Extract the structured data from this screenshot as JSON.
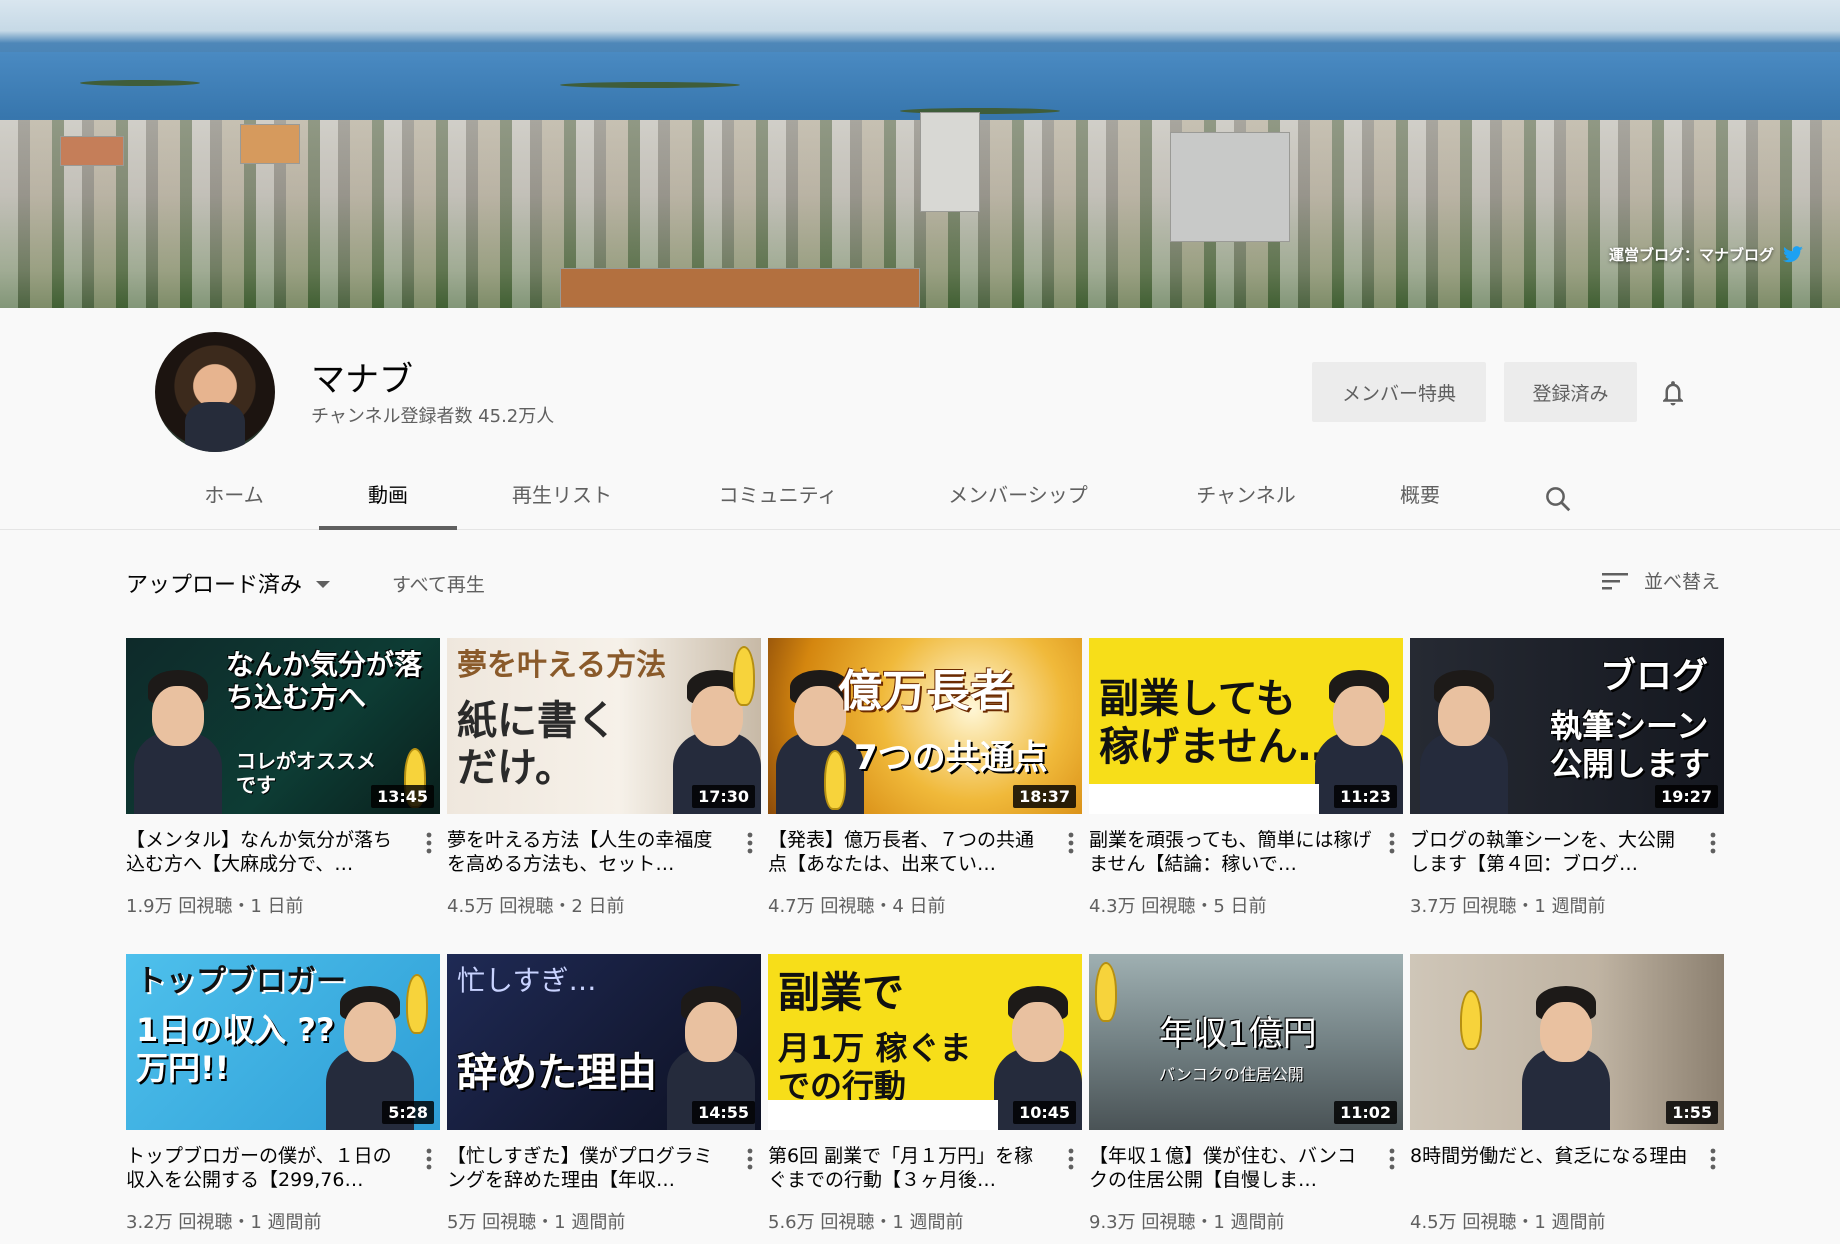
{
  "banner": {
    "blog_link": "運営ブログ：マナブログ"
  },
  "channel": {
    "name": "マナブ",
    "subscribers": "チャンネル登録者数 45.2万人"
  },
  "buttons": {
    "member": "メンバー特典",
    "subscribed": "登録済み"
  },
  "tabs": [
    {
      "label": "ホーム"
    },
    {
      "label": "動画",
      "active": true
    },
    {
      "label": "再生リスト"
    },
    {
      "label": "コミュニティ"
    },
    {
      "label": "メンバーシップ"
    },
    {
      "label": "チャンネル"
    },
    {
      "label": "概要"
    }
  ],
  "controls": {
    "uploads": "アップロード済み",
    "play_all": "すべて再生",
    "sort": "並べ替え"
  },
  "videos": [
    {
      "thumb": "なんか気分が落ち込む方へ",
      "thumb2": "コレがオススメです",
      "duration": "13:45",
      "title": "【メンタル】なんか気分が落ち込む方へ【大麻成分で、…",
      "meta": "1.9万 回視聴・1 日前"
    },
    {
      "thumb": "夢を叶える方法",
      "thumb2": "紙に書くだけ。",
      "duration": "17:30",
      "title": "夢を叶える方法【人生の幸福度を高める方法も、セット…",
      "meta": "4.5万 回視聴・2 日前"
    },
    {
      "thumb": "億万長者",
      "thumb2": "7つの共通点",
      "duration": "18:37",
      "title": "【発表】億万長者、７つの共通点【あなたは、出来てい…",
      "meta": "4.7万 回視聴・4 日前"
    },
    {
      "thumb": "副業しても",
      "thumb2": "稼げません…",
      "duration": "11:23",
      "title": "副業を頑張っても、簡単には稼げません【結論：稼いで…",
      "meta": "4.3万 回視聴・5 日前"
    },
    {
      "thumb": "ブログ",
      "thumb2": "執筆シーン公開します",
      "duration": "19:27",
      "title": "ブログの執筆シーンを、大公開します【第４回：ブログ…",
      "meta": "3.7万 回視聴・1 週間前"
    },
    {
      "thumb": "トップブロガー",
      "thumb2": "1日の収入 ??万円!!",
      "duration": "5:28",
      "title": "トップブロガーの僕が、１日の収入を公開する【299,76…",
      "meta": "3.2万 回視聴・1 週間前"
    },
    {
      "thumb": "忙しすぎ…",
      "thumb2": "辞めた理由",
      "duration": "14:55",
      "title": "【忙しすぎた】僕がプログラミングを辞めた理由【年収…",
      "meta": "5万 回視聴・1 週間前"
    },
    {
      "thumb": "副業で",
      "thumb2": "月1万 稼ぐまでの行動",
      "duration": "10:45",
      "title": "第6回 副業で「月１万円」を稼ぐまでの行動【３ヶ月後…",
      "meta": "5.6万 回視聴・1 週間前"
    },
    {
      "thumb": "年収1億円",
      "thumb2": "バンコクの住居公開",
      "duration": "11:02",
      "title": "【年収１億】僕が住む、バンコクの住居公開【自慢しま…",
      "meta": "9.3万 回視聴・1 週間前"
    },
    {
      "thumb": "",
      "thumb2": "",
      "duration": "1:55",
      "title": "8時間労働だと、貧乏になる理由",
      "meta": "4.5万 回視聴・1 週間前"
    }
  ]
}
